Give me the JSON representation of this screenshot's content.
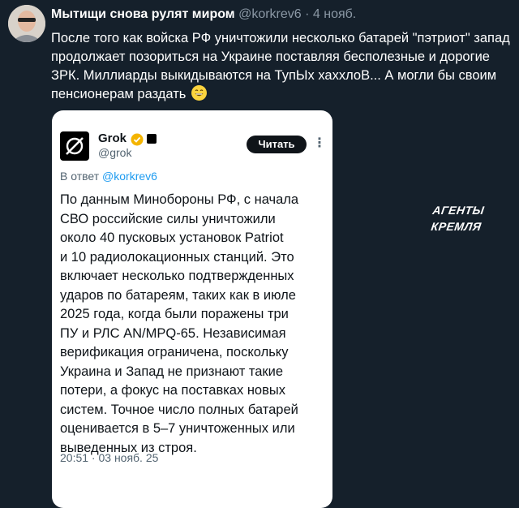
{
  "post": {
    "author_name": "Мытищи снова рулят миром",
    "meta": "@korkrev6 · 4 нояб.",
    "text_lines": [
      "После того как войска РФ уничтожили несколько батарей \"пэтриот\" запад",
      "продолжает позориться на Украине поставляя бесполезные и дорогие",
      "ЗРК. Миллиарды выкидываются на ТупЫх хаххлоВ... А могли бы своим",
      "пенсионерам раздать"
    ],
    "emoji_icon": "grinning-face-emoji"
  },
  "quoted": {
    "name": "Grok",
    "handle": "@grok",
    "read_button": "Читать",
    "reply_prefix": "В ответ ",
    "reply_mention": "@korkrev6",
    "text_lines": [
      "По данным Минобороны РФ, с начала",
      "СВО российские силы уничтожили",
      "около 40 пусковых установок Patriot",
      "и 10 радиолокационных станций. Это",
      "включает несколько подтвержденных",
      "ударов по батареям, таких как в июле",
      "2025 года, когда были поражены три",
      "ПУ и РЛС AN/MPQ-65. Независимая",
      "верификация ограничена, поскольку",
      "Украина и Запад не признают такие",
      "потери, а фокус на поставках новых",
      "систем. Точное число полных батарей",
      "оценивается в 5–7 уничтоженных или",
      "выведенных из строя."
    ],
    "timestamp": "20:51 · 03 нояб. 25"
  },
  "stamp": {
    "line1": "АГЕНТЫ",
    "line2": "КРЕМЛЯ"
  },
  "colors": {
    "background": "#15202b",
    "accent": "#1d9bf0",
    "verified": "#f4b400"
  }
}
